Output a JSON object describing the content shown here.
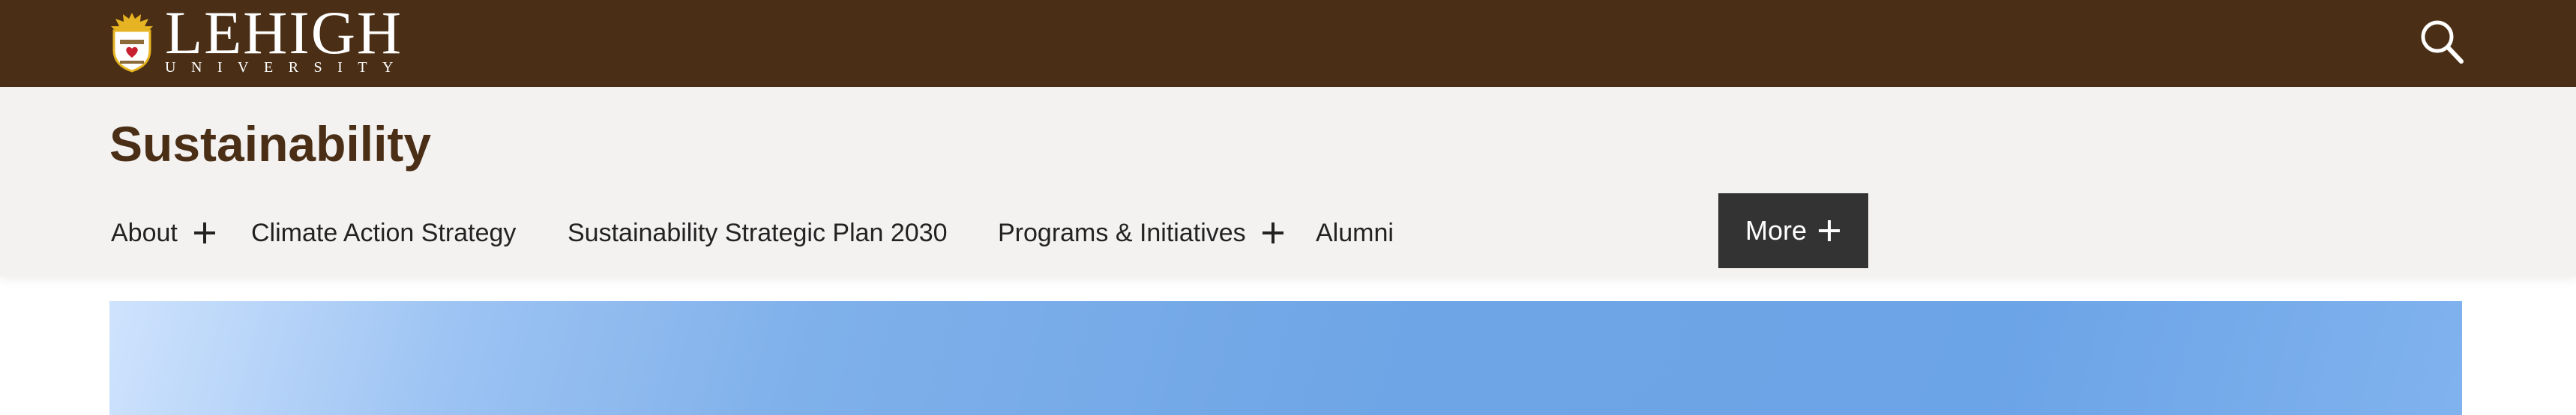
{
  "brand": {
    "name": "LEHIGH",
    "subname": "UNIVERSITY"
  },
  "header": {
    "search_icon": "search-icon",
    "background_color": "#4a2e15"
  },
  "site": {
    "title": "Sustainability"
  },
  "nav": {
    "items": [
      {
        "label": "About",
        "has_submenu": true
      },
      {
        "label": "Climate Action Strategy",
        "has_submenu": false
      },
      {
        "label": "Sustainability Strategic Plan 2030",
        "has_submenu": false
      },
      {
        "label": "Programs & Initiatives",
        "has_submenu": true
      },
      {
        "label": "Alumni",
        "has_submenu": false
      }
    ],
    "more_label": "More"
  },
  "colors": {
    "brand_brown": "#4a2e15",
    "subheader_bg": "#f3f2f1",
    "more_button_bg": "#333333"
  }
}
